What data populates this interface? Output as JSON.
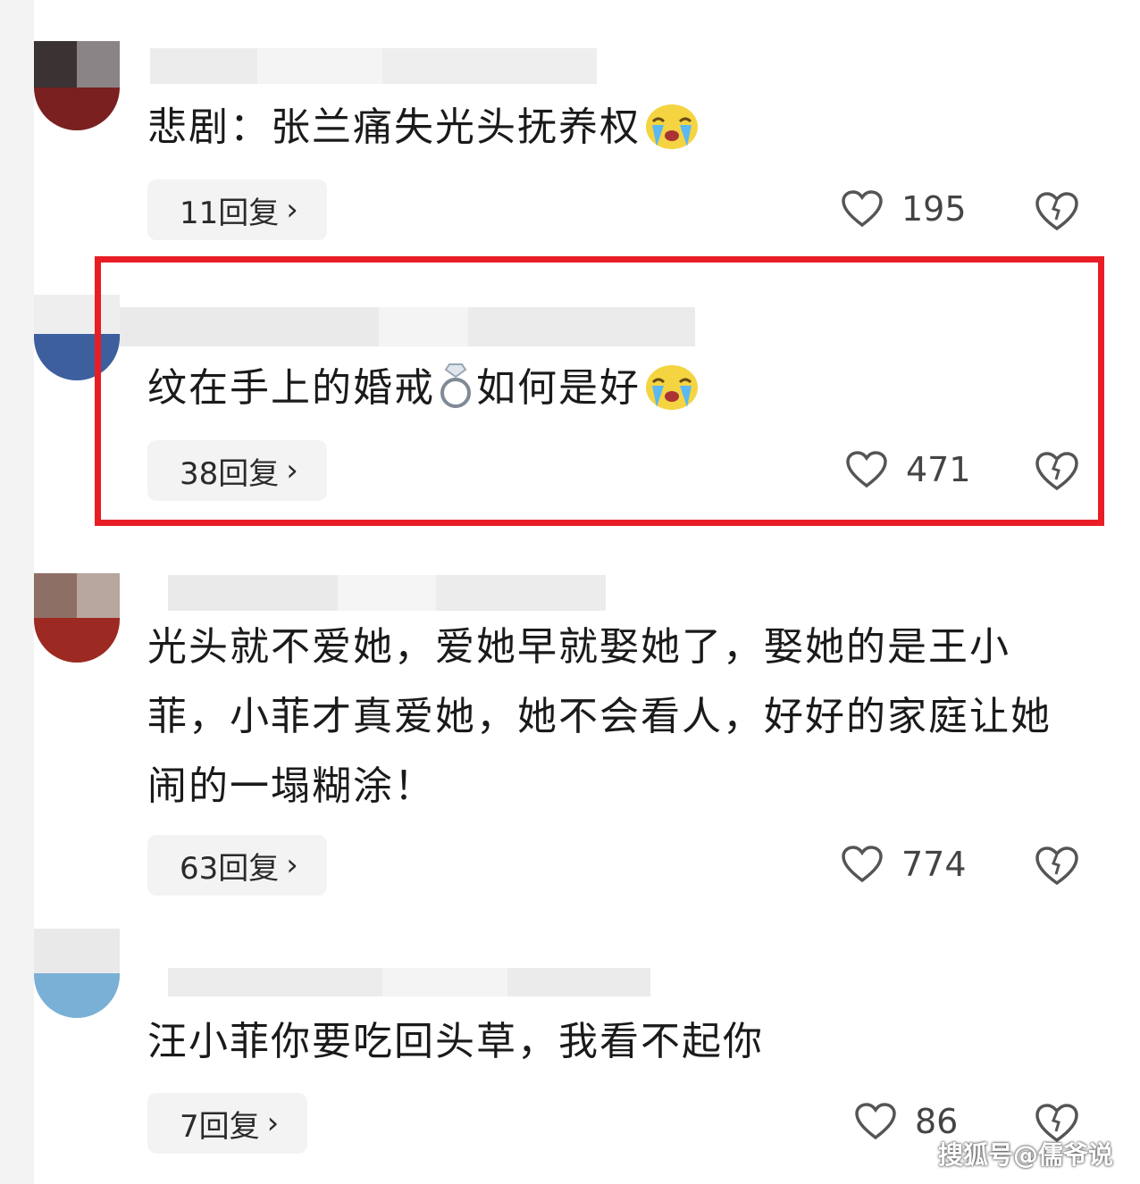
{
  "comments": [
    {
      "text": "悲剧：张兰痛失光头抚养权",
      "emoji": "crying-face-emoji",
      "replies": "11回复",
      "likes": "195"
    },
    {
      "text_before": "纹在手上的婚戒",
      "ring": "ring-emoji",
      "text_after": "如何是好",
      "emoji": "crying-face-emoji",
      "replies": "38回复",
      "likes": "471",
      "highlighted": true
    },
    {
      "text": "光头就不爱她，爱她早就娶她了，娶她的是王小菲，小菲才真爱她，她不会看人，好好的家庭让她闹的一塌糊涂！",
      "replies": "63回复",
      "likes": "774"
    },
    {
      "text": "汪小菲你要吃回头草，我看不起你",
      "replies": "7回复",
      "likes": "86"
    }
  ],
  "watermark": "搜狐号@儒爷说",
  "colors": {
    "highlight": "#e81d25",
    "pill_bg": "#f3f3f3"
  },
  "icons": {
    "like": "heart-icon",
    "dislike": "dislike-heart-icon",
    "chevron": "chevron-right-icon"
  },
  "chevron_glyph": "›"
}
